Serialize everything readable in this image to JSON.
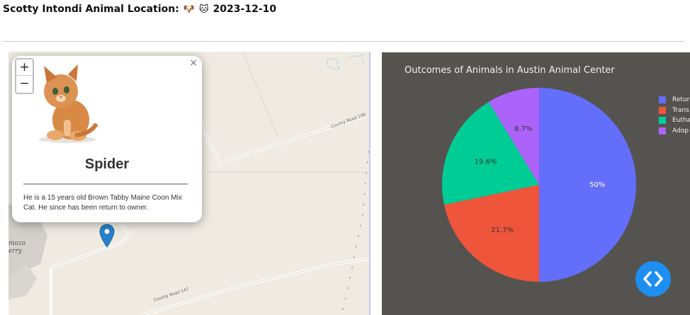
{
  "header": {
    "title": "Scotty Intondi Animal Location:",
    "dog_emoji": "🐶",
    "cat_emoji": "🐱",
    "date": "2023-12-10"
  },
  "map": {
    "zoom_in": "+",
    "zoom_out": "−",
    "road_labels": [
      "County Road 146",
      "County Road 147"
    ],
    "side_labels": [
      "moza",
      "erry"
    ],
    "popup": {
      "close": "×",
      "name": "Spider",
      "description": "He is a 15 years old Brown Tabby Maine Coon Mix Cat. He since has been return to owner."
    }
  },
  "chart_data": {
    "type": "pie",
    "title": "Outcomes of Animals in Austin Animal Center",
    "slices": [
      {
        "label": "Retur",
        "value": 50,
        "text": "50%",
        "color": "#636efa"
      },
      {
        "label": "Trans",
        "value": 21.7,
        "text": "21.7%",
        "color": "#ef553b"
      },
      {
        "label": "Eutha",
        "value": 19.6,
        "text": "19.6%",
        "color": "#00cc96"
      },
      {
        "label": "Adop",
        "value": 8.7,
        "text": "8.7%",
        "color": "#ab63fa"
      }
    ],
    "legend_position": "right"
  },
  "colors": {
    "chart_background": "#555350",
    "map_background": "#efebe3",
    "marker": "#2a81cb",
    "nav_button": "#1e8ff0"
  },
  "icons": {
    "nav_button": "code-arrows-icon",
    "marker": "map-pin-icon"
  }
}
